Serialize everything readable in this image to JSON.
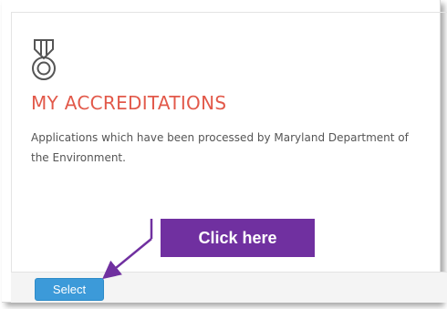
{
  "panel": {
    "icon": "medal-icon",
    "title": "MY ACCREDITATIONS",
    "description": "Applications which have been processed by Maryland Department of the Environment.",
    "select_label": "Select"
  },
  "callout": {
    "text": "Click here"
  },
  "colors": {
    "title": "#e2594a",
    "button": "#3c9ad9",
    "callout": "#7030a0",
    "footer": "#f4f4f4"
  }
}
